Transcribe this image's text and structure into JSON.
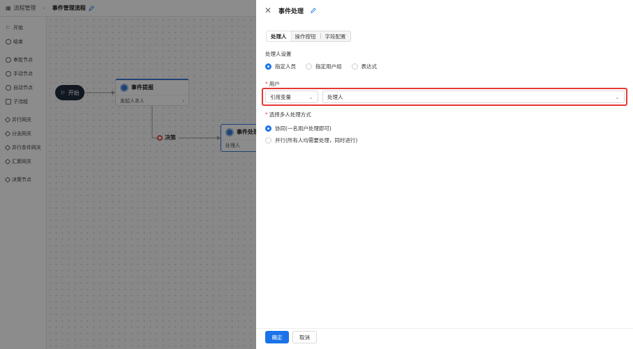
{
  "breadcrumb": {
    "root": "流程管理",
    "current": "事件管理流程"
  },
  "sidebar": {
    "items": [
      {
        "label": "开始"
      },
      {
        "label": "结束"
      },
      {
        "label": "审批节点"
      },
      {
        "label": "手动节点"
      },
      {
        "label": "自动节点"
      },
      {
        "label": "子流程"
      },
      {
        "label": "并行网关"
      },
      {
        "label": "分支网关"
      },
      {
        "label": "并行条件网关"
      },
      {
        "label": "汇聚网关"
      },
      {
        "label": "决策节点"
      }
    ]
  },
  "canvas": {
    "start_label": "开始",
    "node1": {
      "title": "事件提报",
      "sub": "发起人本人"
    },
    "decision_label": "决策",
    "node2": {
      "title": "事件处理",
      "sub": "处理人"
    }
  },
  "drawer": {
    "title": "事件处理",
    "tabs": [
      "处理人",
      "操作按钮",
      "字段配置"
    ],
    "handler_settings_label": "处理人设置",
    "handler_options": [
      "指定人员",
      "指定用户组",
      "表达式"
    ],
    "user_label": "用户",
    "source_select": "引用变量",
    "value_select": "处理人",
    "multi_label": "选择多人处理方式",
    "multi_options": [
      "协同(一名用户处理即可)",
      "并行(所有人均需要处理，同时进行)"
    ],
    "ok_button": "确定",
    "cancel_button": "取消"
  },
  "colors": {
    "primary": "#1a73e8",
    "highlight_border": "#e53935",
    "required_mark": "#e34a4a"
  }
}
